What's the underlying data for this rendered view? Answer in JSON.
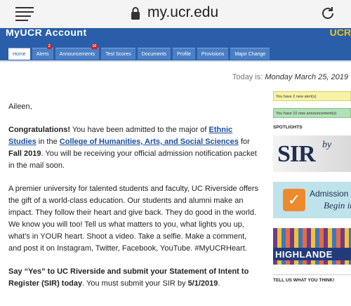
{
  "browser": {
    "url": "my.ucr.edu",
    "menu_icon": "hamburger-icon",
    "lock_icon": "lock-icon",
    "reload_icon": "reload-icon"
  },
  "header": {
    "brand": "MyUCR Account",
    "brand_right": "UCR",
    "tabs": [
      {
        "label": "Home",
        "badge": ""
      },
      {
        "label": "Alerts",
        "badge": "2"
      },
      {
        "label": "Announcements",
        "badge": "10"
      },
      {
        "label": "Test Scores",
        "badge": ""
      },
      {
        "label": "Documents",
        "badge": ""
      },
      {
        "label": "Profile",
        "badge": ""
      },
      {
        "label": "Provisions",
        "badge": ""
      },
      {
        "label": "Major Change",
        "badge": ""
      }
    ]
  },
  "date": {
    "prefix": "Today is:",
    "value": "Monday March 25, 2019"
  },
  "message": {
    "greeting": "Aileen,",
    "congrats": "Congratulations!",
    "admitted_text": "You have been admitted to the major of",
    "major_link": "Ethnic Studies",
    "in_the": "in the",
    "college_link": "College of Humanities, Arts, and Social Sciences",
    "for_text": "for",
    "term": "Fall 2019",
    "packet_text": ". You will be receiving your official admission notification packet in the mail soon.",
    "paragraph2": "A premier university for talented students and faculty, UC Riverside offers the gift of a world-class education. Our students and alumni make an impact. They follow their heart and give back. They do good in the world. We know you will too! Tell us what matters to you, what lights you up, what's in YOUR heart. Shoot a video. Take a selfie. Make a comment, and post it on Instagram, Twitter, Facebook, YouTube. #MyUCRHeart.",
    "sir_heading": "Say “Yes” to UC Riverside and submit your Statement of Intent to Register (SIR) today",
    "sir_text": ". You must submit your SIR by",
    "sir_deadline": "5/1/2019",
    "sir_end": "."
  },
  "sidebar": {
    "alert1": "You have 2 new alert(s)",
    "alert2": "You have 10 new announcement(s)",
    "spotlights": "SPOTLIGHTS",
    "promo1_big": "SIR",
    "promo1_small": "by",
    "promo2_line1": "Admission",
    "promo2_line2": "Begin in",
    "promo3_text": "HIGHLANDE",
    "tell_us": "TELL US WHAT YOU THINK!"
  },
  "colors": {
    "header_blue": "#2a5ea8",
    "link_blue": "#1a4fa0",
    "alert_yellow": "#f6f3a6",
    "alert_green": "#b3e0b6",
    "badge_red": "#d21f1f"
  }
}
